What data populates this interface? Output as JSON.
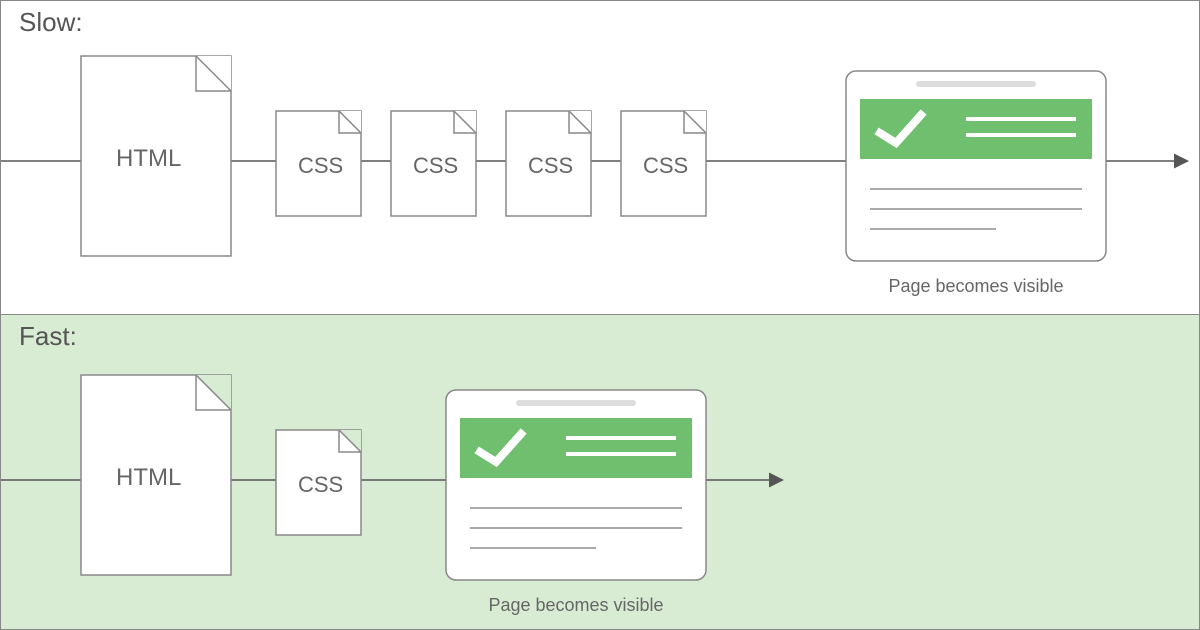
{
  "slow": {
    "label": "Slow:",
    "html": "HTML",
    "css": [
      "CSS",
      "CSS",
      "CSS",
      "CSS"
    ],
    "caption": "Page becomes visible"
  },
  "fast": {
    "label": "Fast:",
    "html": "HTML",
    "css": [
      "CSS"
    ],
    "caption": "Page becomes visible"
  },
  "colors": {
    "stroke": "#888888",
    "green": "#6fbf6f",
    "fastBg": "#d8ecd4"
  }
}
